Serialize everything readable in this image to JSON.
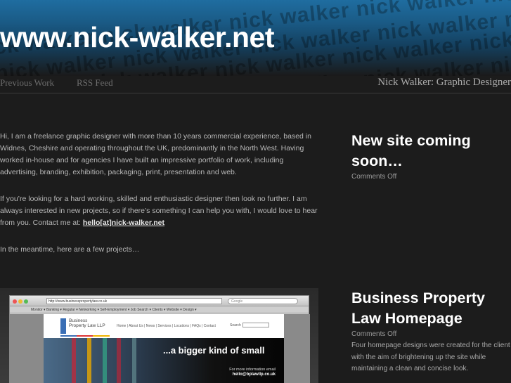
{
  "header": {
    "site_title": "www.nick-walker.net",
    "watermark_text": "nick walker nick walker nick walker nick walker nick walker nick walker nick walker"
  },
  "nav": {
    "items": [
      {
        "label": "Previous Work"
      },
      {
        "label": "RSS Feed"
      }
    ],
    "tagline": "Nick Walker: Graphic Designer"
  },
  "intro": {
    "para1": "Hi, I am a freelance graphic designer with more than 10 years commercial experience, based in Widnes, Cheshire and operating throughout the UK, predominantly in the North West. Having worked in-house and for agencies I have built an impressive portfolio of work, including advertising, branding, exhibition, packaging, print, presentation and web.",
    "para2_text": "If you’re looking for a hard working, skilled and enthusiastic designer then look no further. I am always interested in new projects, so if there’s something I can help you with, I would love to hear from you. Contact me at: ",
    "email": "hello[at]nick-walker.net",
    "para3": "In the meantime, here are a few projects…"
  },
  "project_screenshot": {
    "url": "http://www.businesspropertylaw.co.uk",
    "search_placeholder": "Google",
    "bookmarks": "Monitor ▾   Banking ▾   Regular ▾   Networking ▾   Self-Employment ▾   Job Search ▾   Clients ▾   Website ▾   Design ▾",
    "logo_line1": "Business",
    "logo_line2": "Property Law LLP",
    "site_nav": "Home | About Us | News | Services | Locations | FAQs | Contact",
    "search_label": "Search",
    "hero_text": "...a bigger kind of small",
    "hero_info": "For more information email",
    "hero_email": "hello@bplawllp.co.uk"
  },
  "posts": [
    {
      "title": "New site coming soon…",
      "meta": "Comments Off",
      "excerpt": ""
    },
    {
      "title": "Business Property Law Homepage",
      "meta": "Comments Off",
      "excerpt": "Four homepage designs were created for the client with the aim of brightening up the site while maintaining a clean and concise look."
    }
  ],
  "colors": {
    "background": "#1c1c1c",
    "header_blue": "#1f6da0",
    "title_white": "#ffffff",
    "text_grey": "#b8b8b8"
  }
}
